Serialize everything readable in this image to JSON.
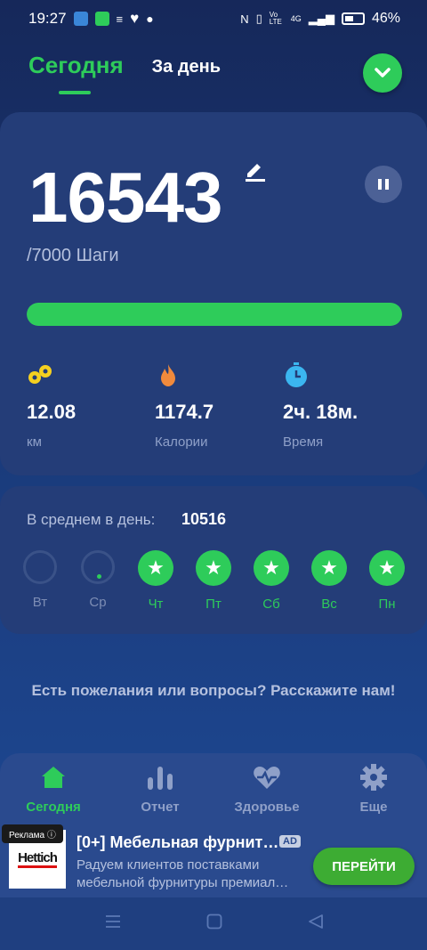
{
  "status_bar": {
    "time": "19:27",
    "network": "4G",
    "volte": "Vo LTE",
    "battery": "46%"
  },
  "tabs": {
    "today": "Сегодня",
    "per_day": "За день"
  },
  "today": {
    "steps": "16543",
    "goal_label": "/7000 Шаги",
    "progress_fraction": 1.0,
    "stats": [
      {
        "icon": "distance-icon",
        "value": "12.08",
        "label": "км",
        "color": "#f5d020"
      },
      {
        "icon": "flame-icon",
        "value": "1174.7",
        "label": "Калории",
        "color": "#f08a3c"
      },
      {
        "icon": "stopwatch-icon",
        "value": "2ч. 18м.",
        "label": "Время",
        "color": "#3bb6f0"
      }
    ]
  },
  "average": {
    "label": "В среднем в день:",
    "value": "10516",
    "days": [
      {
        "label": "Вт",
        "done": false
      },
      {
        "label": "Ср",
        "done": false
      },
      {
        "label": "Чт",
        "done": true
      },
      {
        "label": "Пт",
        "done": true
      },
      {
        "label": "Сб",
        "done": true
      },
      {
        "label": "Вс",
        "done": true
      },
      {
        "label": "Пн",
        "done": true
      }
    ]
  },
  "feedback": "Есть пожелания или вопросы? Расскажите нам!",
  "bottom_nav": [
    {
      "icon": "home-icon",
      "label": "Сегодня",
      "active": true
    },
    {
      "icon": "bar-chart-icon",
      "label": "Отчет",
      "active": false
    },
    {
      "icon": "heart-pulse-icon",
      "label": "Здоровье",
      "active": false
    },
    {
      "icon": "gear-icon",
      "label": "Еще",
      "active": false
    }
  ],
  "ad": {
    "tag": "Реклама",
    "logo_text": "Hettich",
    "title": "[0+] Мебельная фурнит…",
    "badge": "AD",
    "description": "Радуем клиентов поставками мебельной фурнитуры премиал…",
    "button": "ПЕРЕЙТИ"
  },
  "colors": {
    "accent": "#2ecc5a",
    "card": "#243d78"
  }
}
